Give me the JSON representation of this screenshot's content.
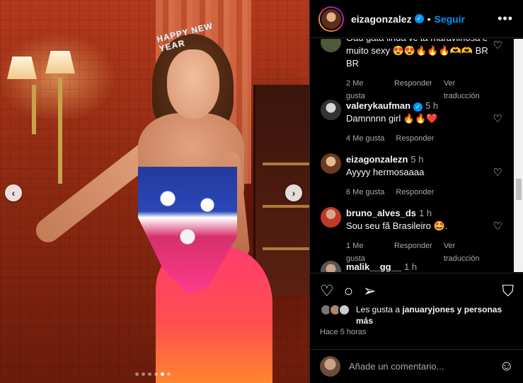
{
  "post": {
    "carousel_dots": 6,
    "active_dot": 4,
    "crown_text": "HAPPY NEW YEAR"
  },
  "header": {
    "username": "eizagonzalez",
    "follow_label": "Seguir",
    "separator": "•",
    "more_label": "•••"
  },
  "comments": [
    {
      "user": "",
      "text": "Oau gata linda vc ta maravilhosa e muito sexy 😍😍🔥🔥🔥🫶🫶 BR BR",
      "time": "",
      "likes": "2 Me gusta",
      "reply": "Responder",
      "translate": "Ver traducción"
    },
    {
      "user": "valerykaufman",
      "verified": true,
      "time": "5 h",
      "text": "Damnnnn girl 🔥🔥❤️",
      "likes": "4 Me gusta",
      "reply": "Responder"
    },
    {
      "user": "eizagonzalezn",
      "time": "5 h",
      "text": "Ayyyy hermosaaaa",
      "likes": "6 Me gusta",
      "reply": "Responder"
    },
    {
      "user": "bruno_alves_ds",
      "time": "1 h",
      "text": "Sou seu fã Brasileiro 🤩.",
      "likes": "1 Me gusta",
      "reply": "Responder",
      "translate": "Ver traducción"
    },
    {
      "user": "malik__gg__",
      "time": "1 h",
      "text": ""
    }
  ],
  "likes": {
    "prefix": "Les gusta a ",
    "user": "januaryjones",
    "suffix": " y personas más"
  },
  "posted": "Hace 5 horas",
  "add_comment": {
    "placeholder": "Añade un comentario..."
  },
  "colors": {
    "accent": "#0095f6",
    "secondary_text": "#a8a8a8",
    "background": "#000000"
  }
}
